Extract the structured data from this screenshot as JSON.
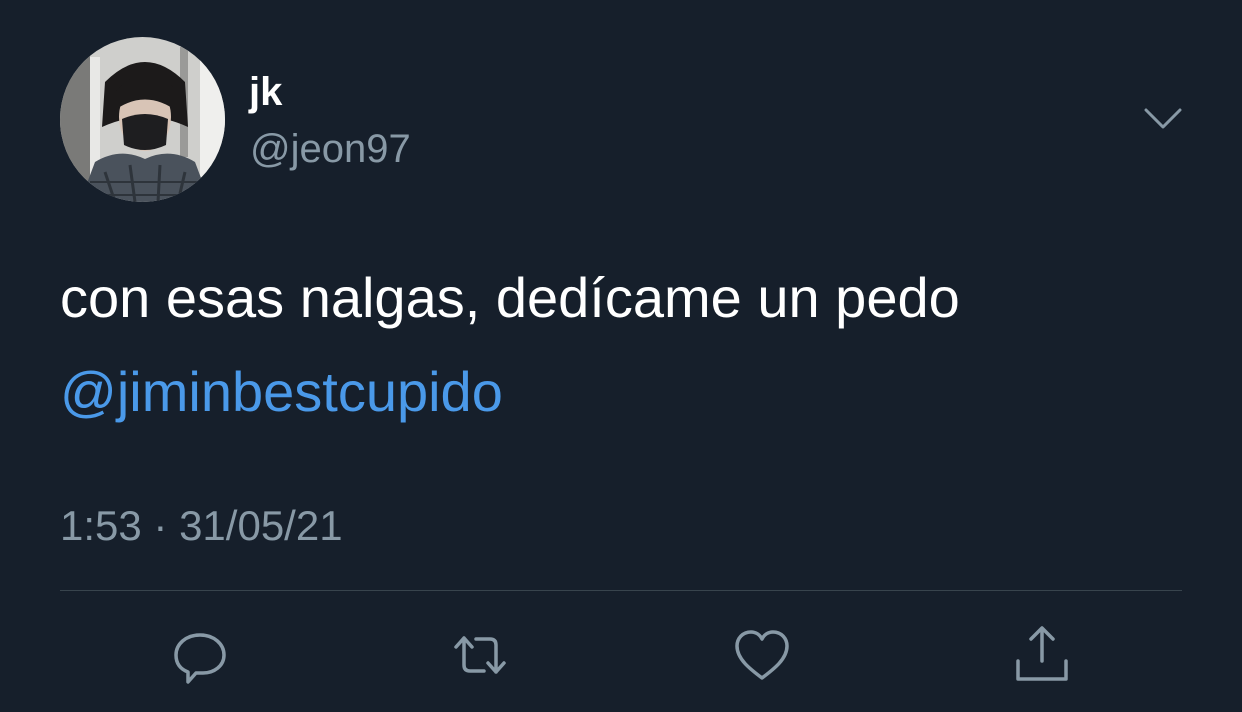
{
  "author": {
    "display_name": "jk",
    "handle": "@jeon97",
    "avatar": "profile-photo"
  },
  "tweet": {
    "text": "con esas nalgas, dedícame un pedo",
    "mention": "@jiminbestcupido",
    "timestamp": "1:53 · 31/05/21"
  },
  "actions": [
    "reply-icon",
    "retweet-icon",
    "like-icon",
    "share-icon"
  ],
  "colors": {
    "background": "#161f2b",
    "text": "#ffffff",
    "muted": "#8899a6",
    "link": "#4a99e9",
    "divider": "#38444d"
  }
}
